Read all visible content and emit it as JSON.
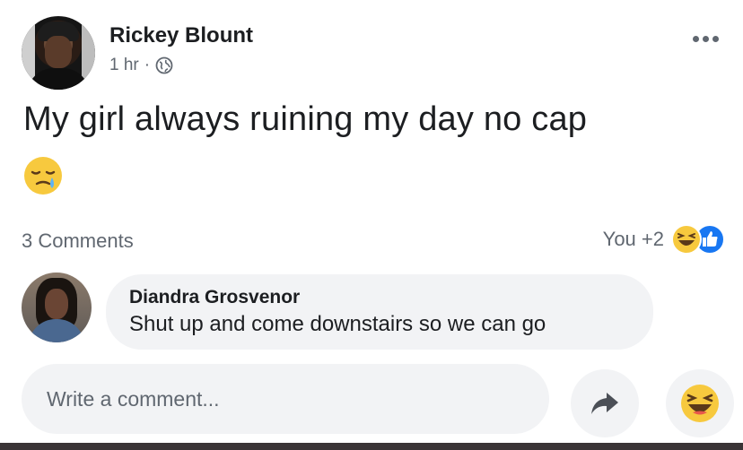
{
  "post": {
    "author": "Rickey Blount",
    "time": "1 hr",
    "separator": "·",
    "privacy_icon": "globe-icon",
    "text": "My girl always ruining my day no cap",
    "emoji": "crying-face-emoji"
  },
  "stats": {
    "comments_count": "3 Comments",
    "reactions_label": "You +2",
    "reaction_icons": [
      "haha-icon",
      "like-icon"
    ]
  },
  "comment": {
    "author": "Diandra Grosvenor",
    "text": "Shut up and come downstairs so we can go"
  },
  "composer": {
    "placeholder": "Write a comment...",
    "share_icon": "share-arrow-icon",
    "reaction_icon": "haha-icon"
  },
  "colors": {
    "text": "#1c1e21",
    "secondary": "#606770",
    "bubble": "#f2f3f5",
    "like_blue": "#1877f2",
    "emoji_yellow": "#f7c93e"
  }
}
